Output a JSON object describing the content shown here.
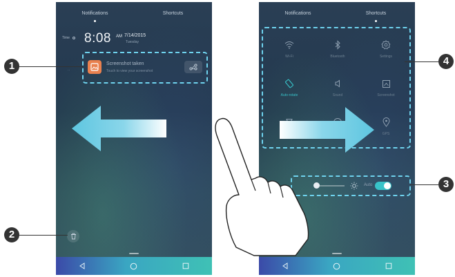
{
  "left_phone": {
    "tabs": [
      {
        "label": "Notifications",
        "active": true
      },
      {
        "label": "Shortcuts",
        "active": false
      }
    ],
    "time_label": "Time",
    "time": "8:08",
    "ampm": "AM",
    "date": "7/14/2015",
    "weekday": "Tuesday",
    "notification": {
      "title": "Screenshot taken",
      "subtitle": "Touch to view your screenshot",
      "icon": "gallery-icon",
      "action_icon": "share-icon"
    },
    "clear_icon": "trash-icon"
  },
  "right_phone": {
    "tabs": [
      {
        "label": "Notifications",
        "active": false
      },
      {
        "label": "Shortcuts",
        "active": true
      }
    ],
    "shortcuts": [
      {
        "label": "Wi-Fi",
        "icon": "wifi-icon",
        "active": false
      },
      {
        "label": "Bluetooth",
        "icon": "bluetooth-icon",
        "active": false
      },
      {
        "label": "Settings",
        "icon": "gear-icon",
        "active": false
      },
      {
        "label": "Auto-rotate",
        "icon": "rotate-icon",
        "active": true
      },
      {
        "label": "Sound",
        "icon": "speaker-icon",
        "active": false
      },
      {
        "label": "Screenshot",
        "icon": "screenshot-icon",
        "active": false
      },
      {
        "label": "Flashlight",
        "icon": "flashlight-icon",
        "active": false
      },
      {
        "label": "",
        "icon": "location-icon",
        "active": false
      },
      {
        "label": "GPS",
        "icon": "location-pin-icon",
        "active": false
      }
    ],
    "brightness": {
      "level": 0.1,
      "auto_label": "Auto",
      "auto_on": true
    }
  },
  "callouts": [
    "1",
    "2",
    "3",
    "4"
  ],
  "colors": {
    "accent": "#38c3c9",
    "highlight": "#6fd3ee",
    "callout": "#333333",
    "notification_icon": "#e9814f"
  }
}
